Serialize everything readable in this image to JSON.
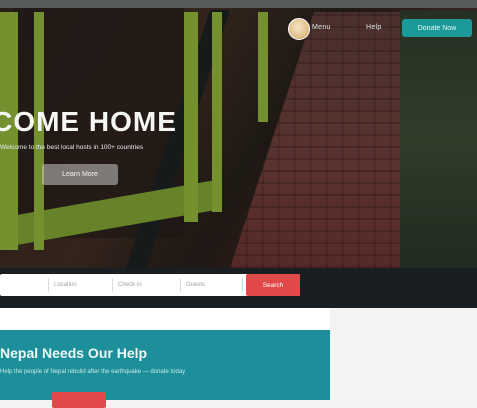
{
  "header": {
    "nav_links": [
      "Menu",
      "Help"
    ],
    "cta_label": "Donate Now"
  },
  "hero": {
    "headline": "LCOME HOME",
    "subtitle": "Welcome to the best local hosts in 100+ countries",
    "cta_label": "Learn More"
  },
  "search": {
    "fields": [
      "Location",
      "Check-in",
      "Guests"
    ],
    "button_label": "Search"
  },
  "promo": {
    "title": "Nepal Needs Our Help",
    "text": "Help the people of Nepal rebuild after the earthquake — donate today"
  },
  "colors": {
    "teal": "#1d8f9a",
    "red": "#e24a49",
    "lime": "#8fb13a"
  }
}
